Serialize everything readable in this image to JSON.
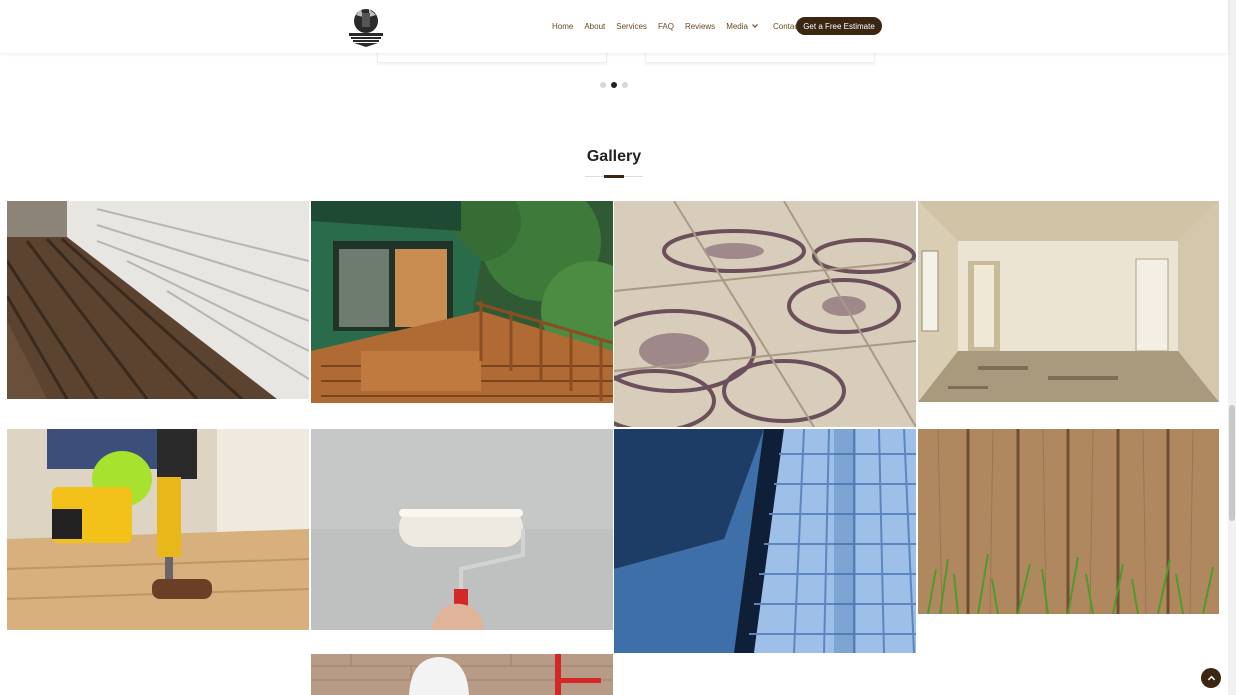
{
  "header": {
    "logo_icon": "company-logo",
    "nav": [
      {
        "label": "Home"
      },
      {
        "label": "About"
      },
      {
        "label": "Services"
      },
      {
        "label": "FAQ"
      },
      {
        "label": "Reviews"
      },
      {
        "label": "Media",
        "has_dropdown": true
      },
      {
        "label": "Contact"
      }
    ],
    "cta_label": "Get a Free Estimate"
  },
  "carousel": {
    "dots_count": 3,
    "active_dot": 2
  },
  "gallery": {
    "title": "Gallery",
    "tiles": [
      {
        "subject": "deck-and-siding-photo"
      },
      {
        "subject": "forest-house-deck-photo"
      },
      {
        "subject": "ornate-floor-tiles-photo"
      },
      {
        "subject": "empty-room-renovation-photo"
      },
      {
        "subject": "power-drill-carpentry-photo"
      },
      {
        "subject": "paint-roller-wall-photo"
      },
      {
        "subject": "blue-pool-tiles-photo"
      },
      {
        "subject": "wood-fence-grass-photo"
      },
      {
        "subject": "construction-worker-photo"
      }
    ]
  },
  "colors": {
    "brand_brown": "#3b2612",
    "nav_text": "#6b4a22",
    "title_text": "#222222"
  },
  "icons": {
    "back_to_top": "chevron-up-icon",
    "dropdown": "chevron-down-icon"
  }
}
